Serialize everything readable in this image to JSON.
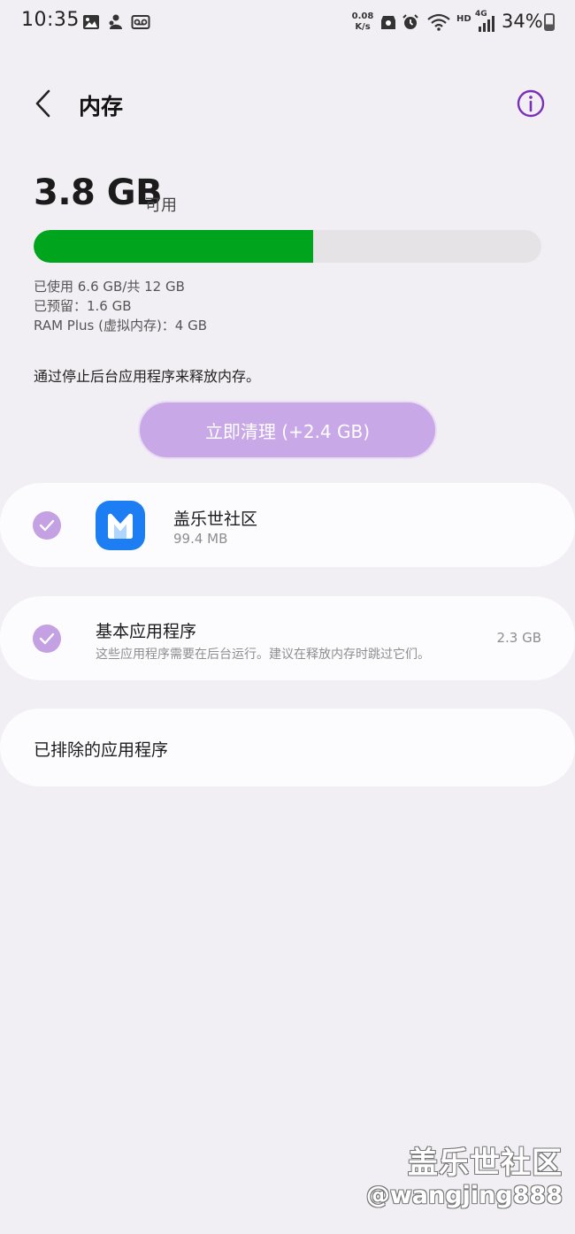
{
  "status_bar": {
    "time": "10:35",
    "net_speed_value": "0.08",
    "net_speed_unit": "K/s",
    "hd_label": "HD",
    "network_type": "4G",
    "battery_percent": "34%",
    "battery_level": 0.34,
    "icons": [
      "gallery-icon",
      "notification-app-icon",
      "voicemail-icon",
      "privacy-icon",
      "alarm-icon",
      "wifi-icon",
      "signal-icon",
      "battery-icon"
    ]
  },
  "header": {
    "title": "内存",
    "back_icon": "chevron-left-icon",
    "info_icon": "info-icon"
  },
  "memory": {
    "available_value": "3.8 GB",
    "available_suffix": "可用",
    "used_fraction": 0.55,
    "used_line": "已使用 6.6 GB/共 12 GB",
    "reserved_line": "已预留：1.6 GB",
    "ram_plus_line": "RAM Plus (虚拟内存)：4 GB",
    "hint": "通过停止后台应用程序来释放内存。",
    "clean_button": "立即清理 (+2.4 GB)",
    "accent_color": "#00a51d"
  },
  "apps": [
    {
      "name": "盖乐世社区",
      "size": "99.4 MB",
      "checked": true,
      "icon": "samsung-members-icon"
    }
  ],
  "basic_apps": {
    "title": "基本应用程序",
    "description": "这些应用程序需要在后台运行。建议在释放内存时跳过它们。",
    "size": "2.3 GB",
    "checked": true
  },
  "excluded_apps": {
    "title": "已排除的应用程序"
  },
  "watermark": {
    "brand": "盖乐世社区",
    "user": "@wangjing888"
  }
}
